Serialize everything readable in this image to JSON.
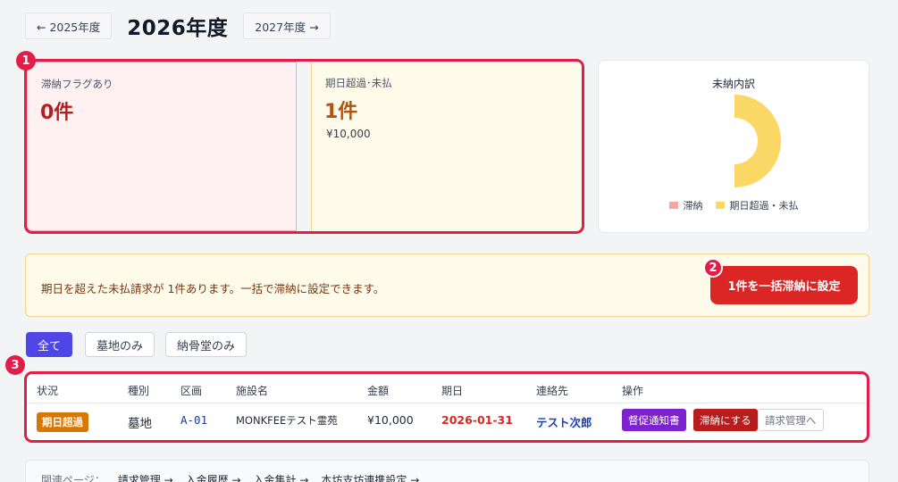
{
  "year_nav": {
    "prev_label": "← 2025年度",
    "current_title": "2026年度",
    "next_label": "2027年度 →"
  },
  "markers": {
    "m1": "1",
    "m2": "2",
    "m3": "3"
  },
  "kpi": [
    {
      "label": "滞納フラグあり",
      "value": "0件",
      "amount": ""
    },
    {
      "label": "期日超過･未払",
      "value": "1件",
      "amount": "¥10,000"
    }
  ],
  "chart": {
    "title": "未納内訳",
    "legend": [
      {
        "label": "滞納",
        "color": "#f4a7a3"
      },
      {
        "label": "期日超過・未払",
        "color": "#fbd765"
      }
    ]
  },
  "chart_data": {
    "type": "pie",
    "title": "未納内訳",
    "categories": [
      "滞納",
      "期日超過・未払"
    ],
    "values": [
      0,
      1
    ],
    "colors": [
      "#f4a7a3",
      "#fbd765"
    ],
    "legend_position": "bottom"
  },
  "alert": {
    "message": "期日を超えた未払請求が 1件あります。一括で滞納に設定できます。",
    "button_label": "1件を一括滞納に設定"
  },
  "filters": [
    "全て",
    "墓地のみ",
    "納骨堂のみ"
  ],
  "table": {
    "headers": [
      "状況",
      "種別",
      "区画",
      "施設名",
      "金額",
      "期日",
      "連絡先",
      "操作"
    ],
    "row": {
      "status": "期日超過",
      "type": "墓地",
      "plot": "A-01",
      "facility": "MONKFEEテスト霊苑",
      "amount": "¥10,000",
      "due": "2026-01-31",
      "contact": "テスト次郎",
      "actions": [
        "督促通知書",
        "滞納にする",
        "請求管理へ"
      ]
    }
  },
  "related": {
    "label": "関連ページ：",
    "links": [
      "請求管理 →",
      "入金履歴 →",
      "入金集計 →",
      "本坊支坊連携設定 →"
    ]
  },
  "colors": {
    "accent_red": "#e11d48",
    "primary_indigo": "#4f46e5",
    "warning_orange": "#d97706"
  }
}
